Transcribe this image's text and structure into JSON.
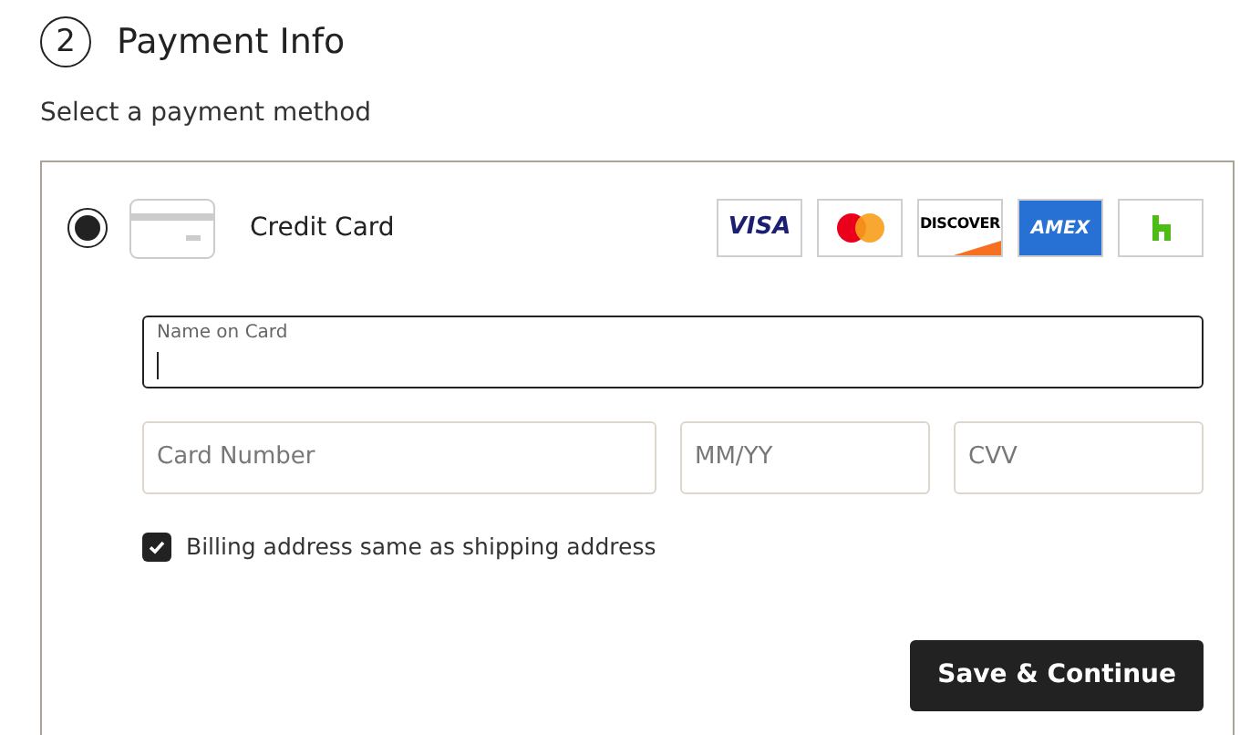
{
  "section": {
    "step": "2",
    "title": "Payment Info",
    "subtitle": "Select a payment method"
  },
  "methods": [
    {
      "label": "Credit Card",
      "selected": true,
      "logos": [
        {
          "kind": "visa",
          "text": "VISA"
        },
        {
          "kind": "mastercard"
        },
        {
          "kind": "discover",
          "text": "DISCOVER"
        },
        {
          "kind": "amex",
          "text": "AMEX"
        },
        {
          "kind": "houzz"
        }
      ]
    }
  ],
  "name_field": {
    "label": "Name on Card",
    "focused": true
  },
  "fields": [
    {
      "placeholder": "Card Number"
    },
    {
      "placeholder": "MM/YY"
    },
    {
      "placeholder": "CVV"
    }
  ],
  "billing_same": {
    "label": "Billing address same as shipping address",
    "checked": true
  },
  "submit": {
    "label": "Save & Continue"
  }
}
